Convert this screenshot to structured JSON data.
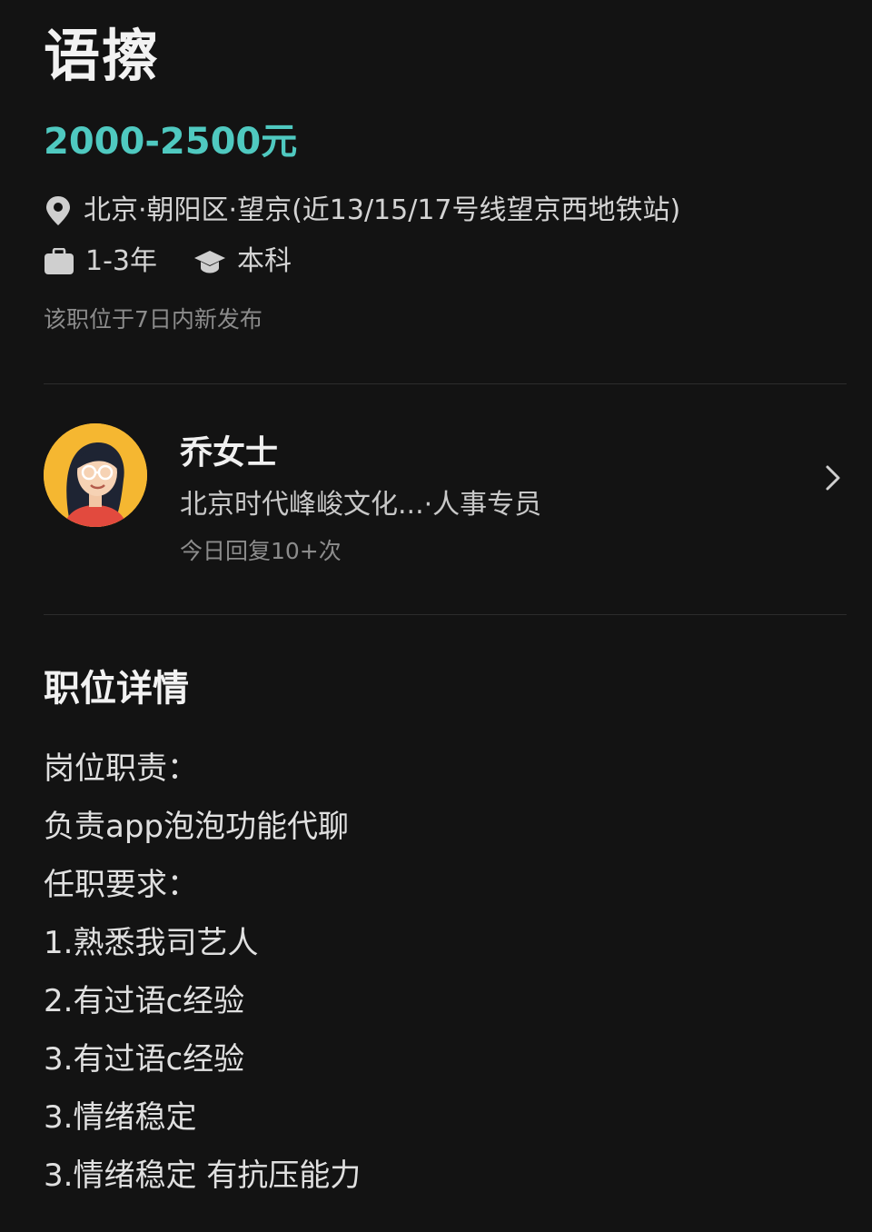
{
  "job": {
    "title": "语擦",
    "salary": "2000-2500元",
    "location": "北京·朝阳区·望京(近13/15/17号线望京西地铁站)",
    "experience": "1-3年",
    "education": "本科",
    "posted": "该职位于7日内新发布"
  },
  "recruiter": {
    "name": "乔女士",
    "company_role": "北京时代峰峻文化...·人事专员",
    "reply_stat": "今日回复10+次"
  },
  "details": {
    "section_title": "职位详情",
    "lines": [
      "岗位职责：",
      "负责app泡泡功能代聊",
      "任职要求：",
      "1.熟悉我司艺人",
      "2.有过语c经验",
      "3.有过语c经验",
      "3.情绪稳定",
      "3.情绪稳定 有抗压能力"
    ]
  },
  "icons": {
    "location": "location-pin-icon",
    "experience": "briefcase-icon",
    "education": "graduation-cap-icon",
    "navigate": "chevron-right-icon"
  },
  "colors": {
    "background": "#131313",
    "salary": "#4fc9c0",
    "avatar_bg": "#f5b731"
  }
}
